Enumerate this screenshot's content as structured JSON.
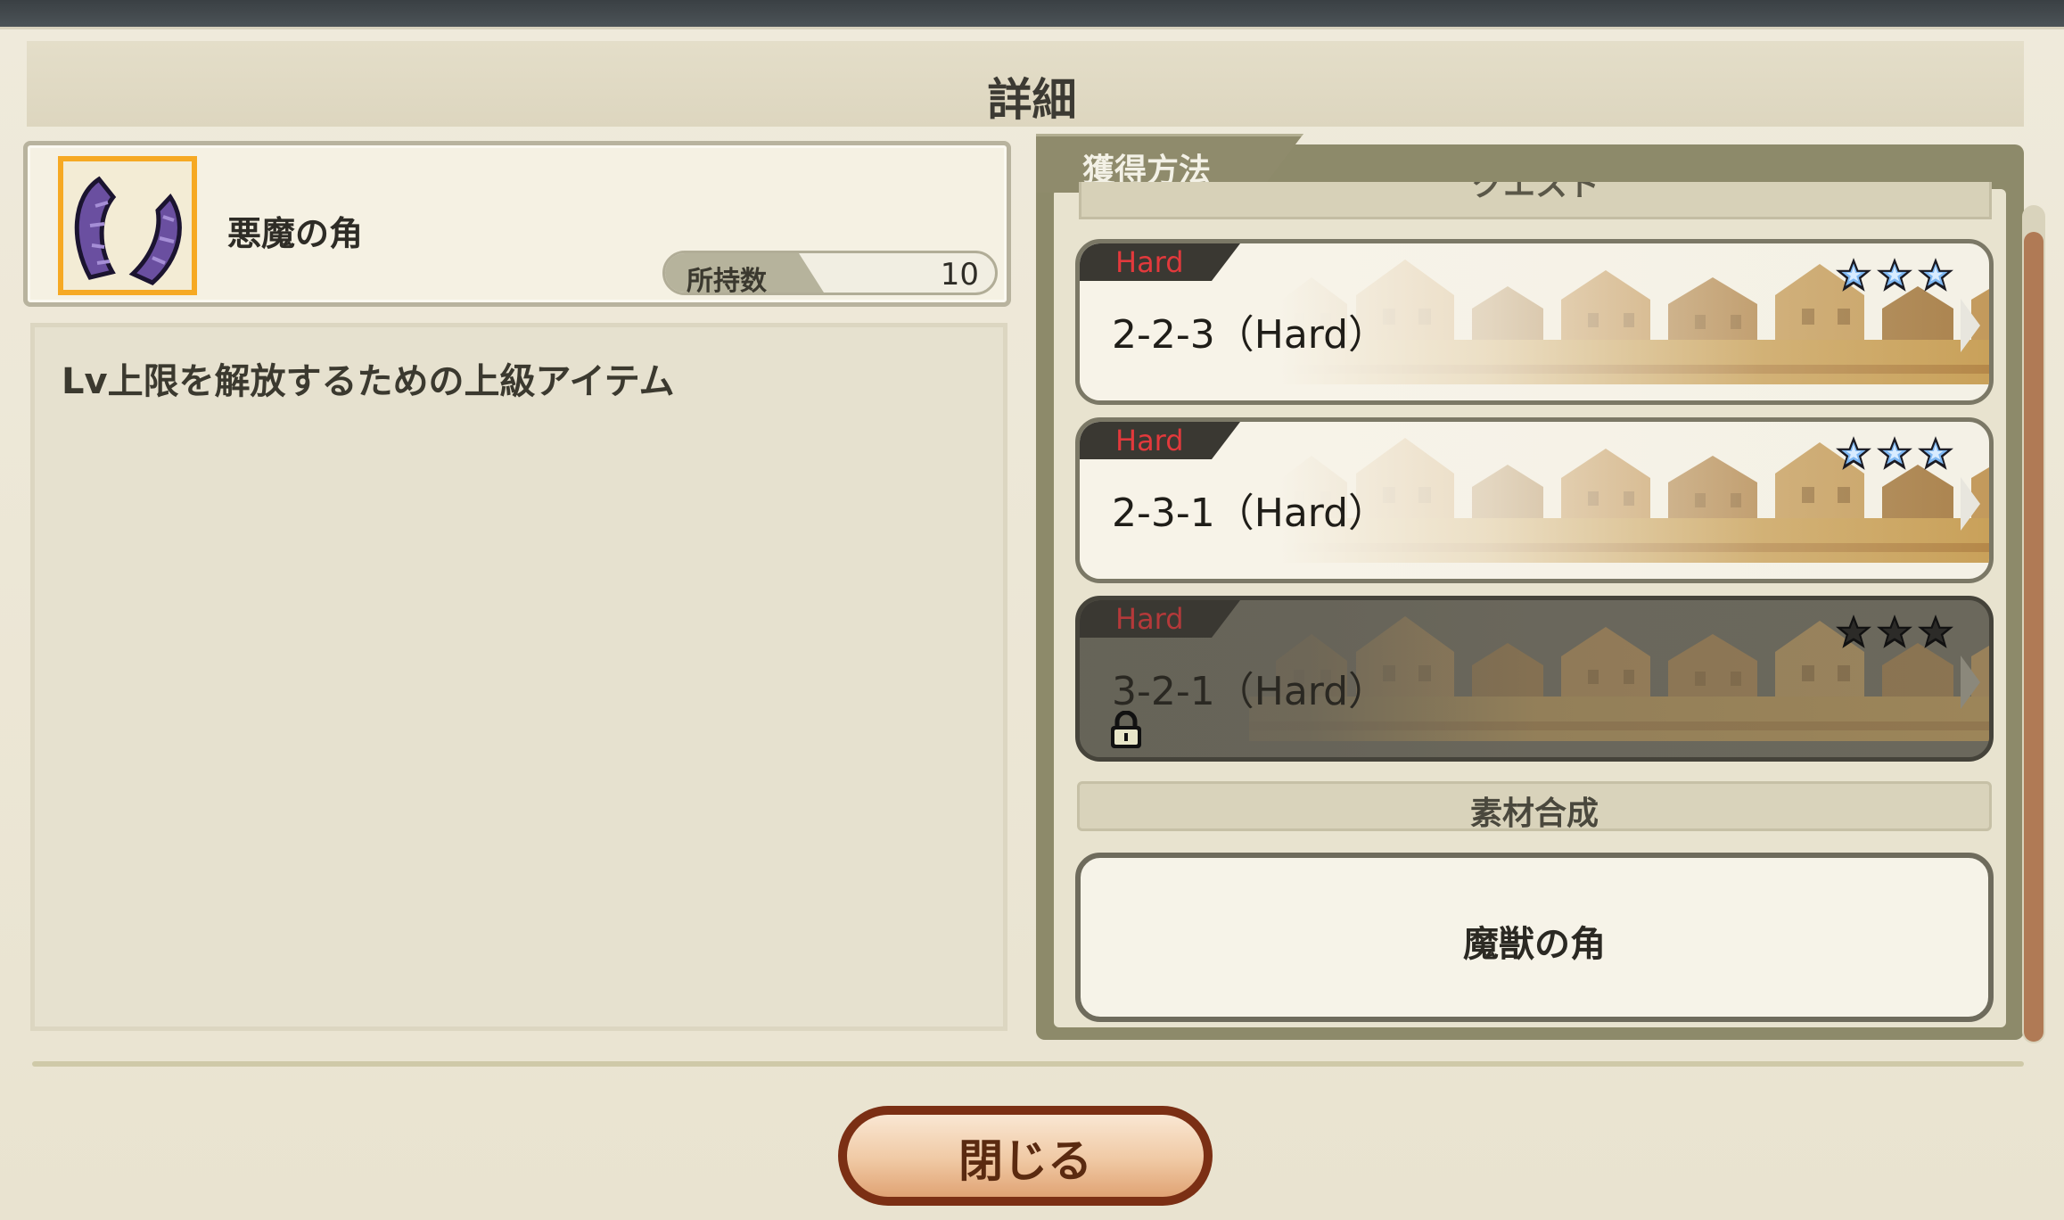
{
  "dialog": {
    "title": "詳細"
  },
  "item": {
    "name": "悪魔の角",
    "icon": "demon-horns-icon",
    "owned_label": "所持数",
    "owned_count": "10",
    "description": "Lv上限を解放するための上級アイテム"
  },
  "acquisition": {
    "tab_label": "獲得方法",
    "section_quest_label": "クエスト",
    "quests": [
      {
        "difficulty": "Hard",
        "name": "2-2-3（Hard）",
        "stars": 3,
        "stars_earned": 3,
        "locked": false
      },
      {
        "difficulty": "Hard",
        "name": "2-3-1（Hard）",
        "stars": 3,
        "stars_earned": 3,
        "locked": false
      },
      {
        "difficulty": "Hard",
        "name": "3-2-1（Hard）",
        "stars": 3,
        "stars_earned": 0,
        "locked": true
      }
    ],
    "synthesis": {
      "label": "素材合成",
      "material": "魔獣の角"
    }
  },
  "buttons": {
    "close_label": "閉じる"
  },
  "colors": {
    "accent_border": "#f6a923",
    "hard_red": "#e2393c",
    "close_button": "#7b2f14",
    "panel_bg": "#efeadb"
  }
}
